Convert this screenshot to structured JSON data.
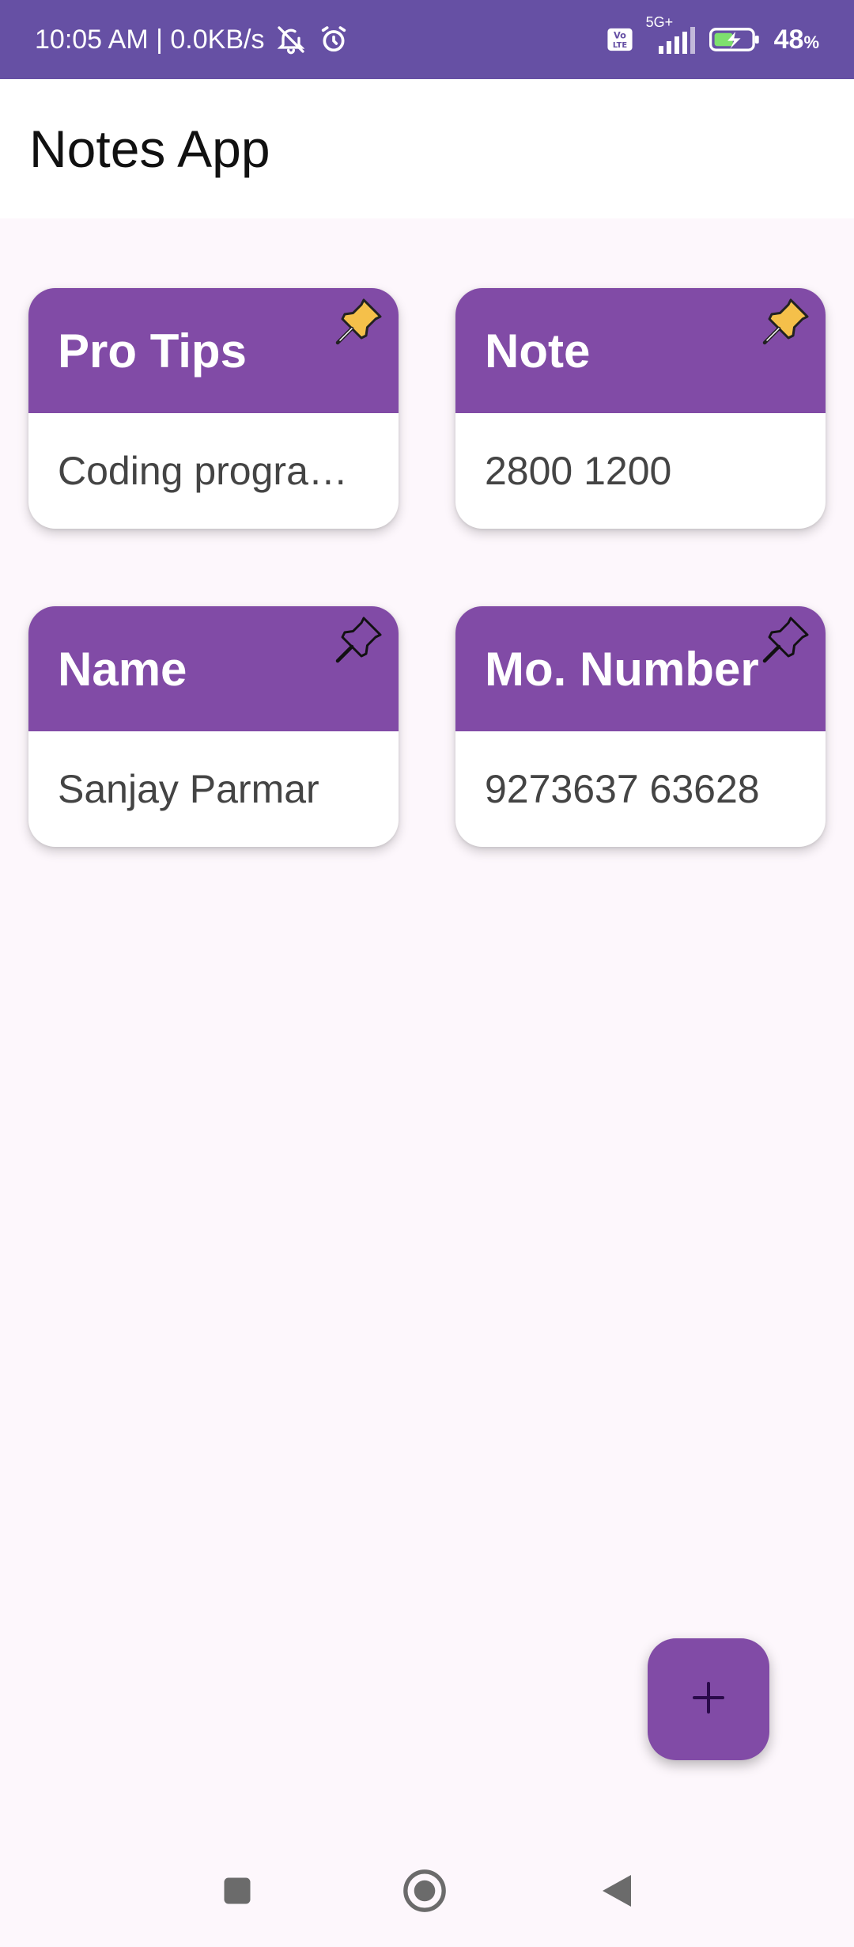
{
  "status_bar": {
    "time_speed": "10:05 AM | 0.0KB/s",
    "network": "5G+",
    "battery": "48",
    "battery_unit": "%"
  },
  "app_bar": {
    "title": "Notes App"
  },
  "notes": [
    {
      "title": "Pro Tips",
      "content": "Coding programming",
      "pinned": true
    },
    {
      "title": "Note",
      "content": "2800 1200",
      "pinned": true
    },
    {
      "title": "Name",
      "content": "Sanjay Parmar",
      "pinned": false
    },
    {
      "title": "Mo. Number",
      "content": "9273637 63628",
      "pinned": false
    }
  ],
  "fab": {
    "icon": "plus-icon"
  },
  "nav_bar": {
    "icons": [
      "recents-icon",
      "home-icon",
      "back-icon"
    ]
  },
  "colors": {
    "status_bar": "#6650A4",
    "note_header": "#814BA6",
    "background": "#FDF7FC",
    "pin_active": "#F5C04A",
    "fab_plus": "#2A0A4A"
  }
}
